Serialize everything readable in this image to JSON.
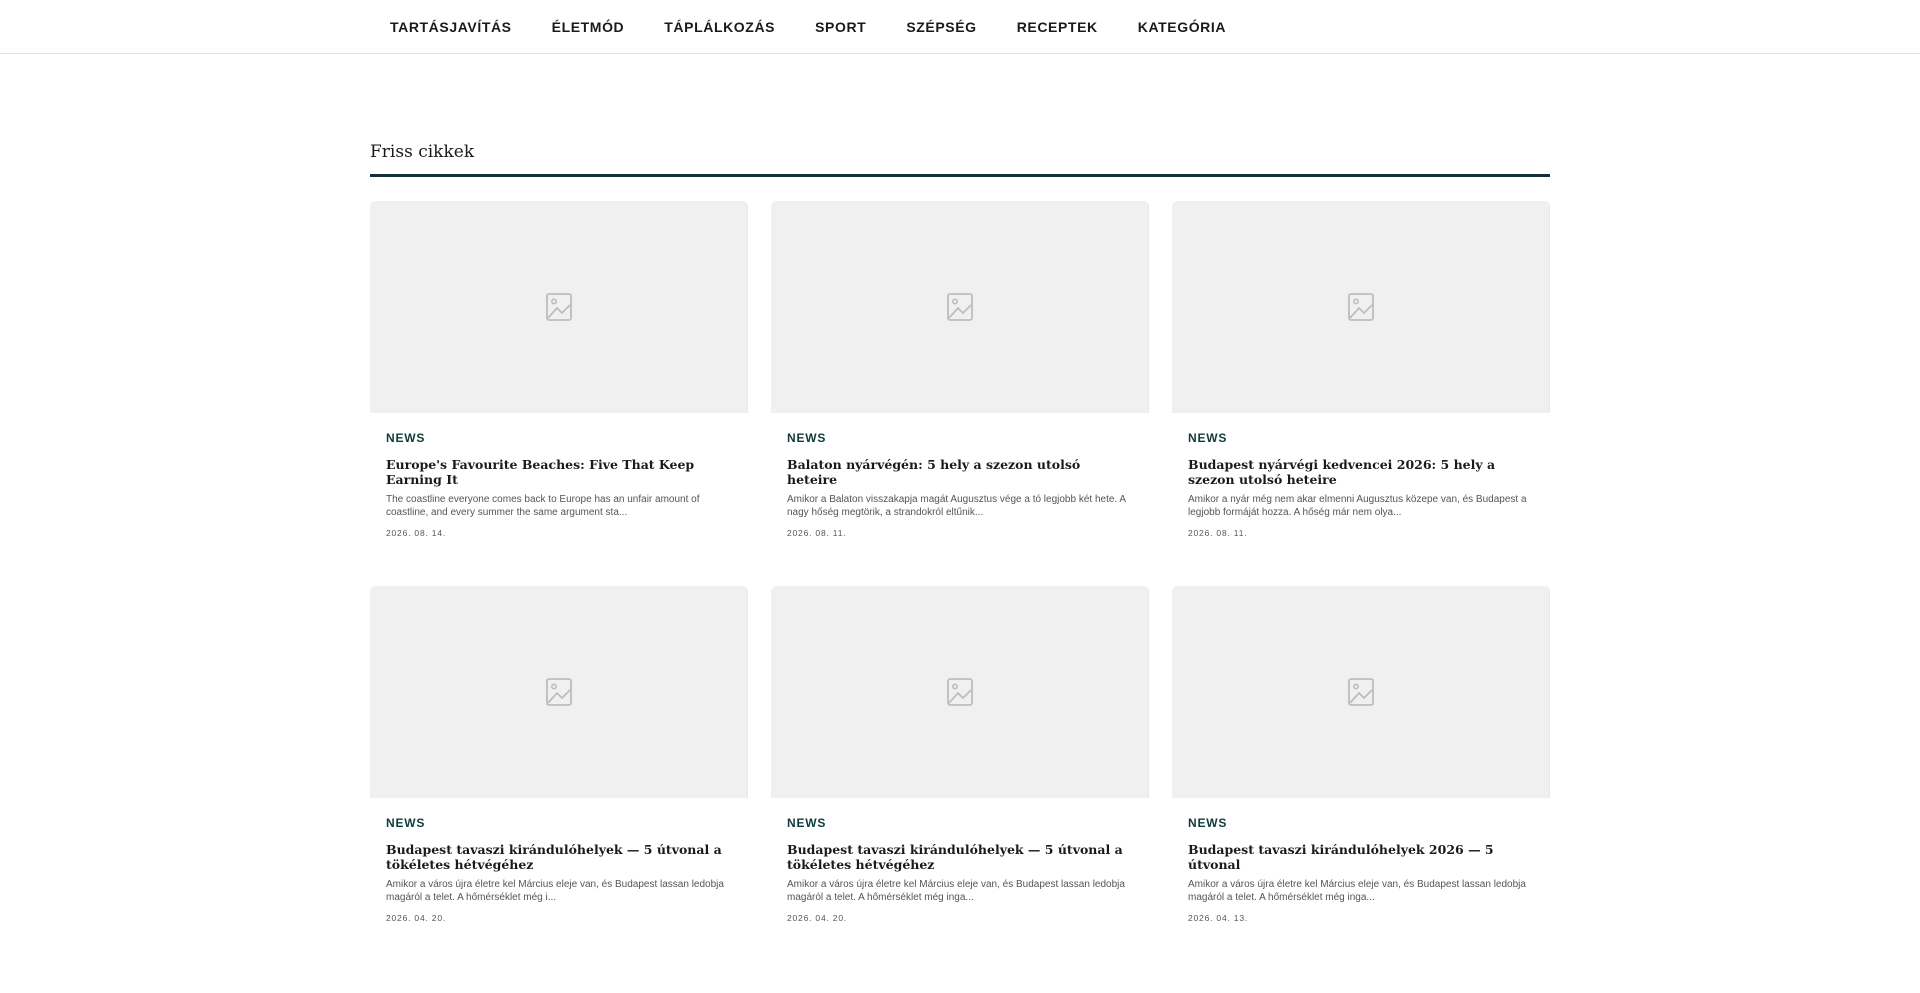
{
  "nav": {
    "items": [
      {
        "label": "TARTÁSJAVÍTÁS"
      },
      {
        "label": "ÉLETMÓD"
      },
      {
        "label": "TÁPLÁLKOZÁS"
      },
      {
        "label": "SPORT"
      },
      {
        "label": "SZÉPSÉG"
      },
      {
        "label": "RECEPTEK"
      },
      {
        "label": "KATEGÓRIA"
      }
    ]
  },
  "section": {
    "title": "Friss cikkek",
    "rule_color": "#12313a"
  },
  "colors": {
    "category": "#0f3b3a",
    "placeholder_bg": "#f0f0f0",
    "placeholder_icon": "#bdbdbd"
  },
  "articles": [
    {
      "category": "NEWS",
      "title": "Europe's Favourite Beaches: Five That Keep Earning It",
      "excerpt": "The coastline everyone comes back to Europe has an unfair amount of coastline, and every summer the same argument sta...",
      "date": "2026. 08. 14.",
      "icon": "image-placeholder-icon"
    },
    {
      "category": "NEWS",
      "title": "Balaton nyárvégén: 5 hely a szezon utolsó heteire",
      "excerpt": "Amikor a Balaton visszakapja magát Augusztus vége a tó legjobb két hete. A nagy hőség megtörik, a strandokról eltűnik...",
      "date": "2026. 08. 11.",
      "icon": "image-placeholder-icon"
    },
    {
      "category": "NEWS",
      "title": "Budapest nyárvégi kedvencei 2026: 5 hely a szezon utolsó heteire",
      "excerpt": "Amikor a nyár még nem akar elmenni Augusztus közepe van, és Budapest a legjobb formáját hozza. A hőség már nem olya...",
      "date": "2026. 08. 11.",
      "icon": "image-placeholder-icon"
    },
    {
      "category": "NEWS",
      "title": "Budapest tavaszi kirándulóhelyek — 5 útvonal a tökéletes hétvégéhez",
      "excerpt": "Amikor a város újra életre kel Március eleje van, és Budapest lassan ledobja magáról a telet. A hőmérséklet még i...",
      "date": "2026. 04. 20.",
      "icon": "image-placeholder-icon"
    },
    {
      "category": "NEWS",
      "title": "Budapest tavaszi kirándulóhelyek — 5 útvonal a tökéletes hétvégéhez",
      "excerpt": "Amikor a város újra életre kel Március eleje van, és Budapest lassan ledobja magáról a telet. A hőmérséklet még inga...",
      "date": "2026. 04. 20.",
      "icon": "image-placeholder-icon"
    },
    {
      "category": "NEWS",
      "title": "Budapest tavaszi kirándulóhelyek 2026 — 5 útvonal",
      "excerpt": "Amikor a város újra életre kel Március eleje van, és Budapest lassan ledobja magáról a telet. A hőmérséklet még inga...",
      "date": "2026. 04. 13.",
      "icon": "image-placeholder-icon"
    }
  ]
}
